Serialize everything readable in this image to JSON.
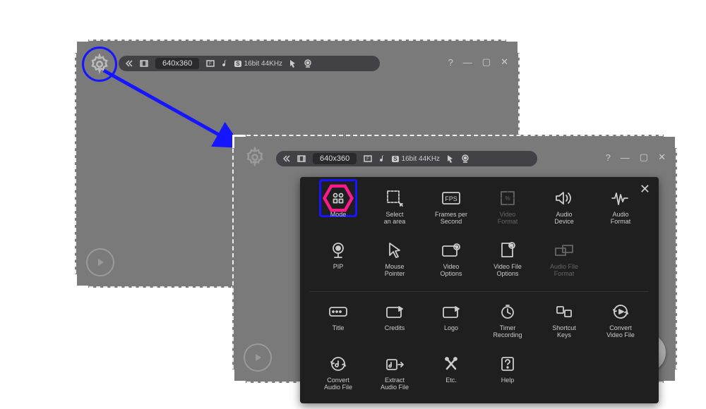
{
  "toolbar": {
    "dimensions": "640x360",
    "audio_badge_prefix": "S",
    "audio_mode": "16bit 44KHz"
  },
  "window_controls": {
    "help": "?",
    "min": "—",
    "max": "▢",
    "close": "✕"
  },
  "panel": {
    "items": [
      {
        "key": "mode",
        "label": "Mode"
      },
      {
        "key": "select-area",
        "label": "Select\nan area"
      },
      {
        "key": "fps",
        "label": "Frames per\nSecond"
      },
      {
        "key": "video-format",
        "label": "Video\nFormat",
        "dim": true
      },
      {
        "key": "audio-device",
        "label": "Audio\nDevice"
      },
      {
        "key": "audio-format",
        "label": "Audio\nFormat"
      },
      {
        "key": "pip",
        "label": "PIP"
      },
      {
        "key": "mouse-pointer",
        "label": "Mouse\nPointer"
      },
      {
        "key": "video-options",
        "label": "Video\nOptions"
      },
      {
        "key": "video-file-options",
        "label": "Video File\nOptions"
      },
      {
        "key": "audio-file-format",
        "label": "Audio File\nFormat",
        "dim": true
      },
      {
        "key": "blank1",
        "blank": true
      },
      {
        "key": "title",
        "label": "Title"
      },
      {
        "key": "credits",
        "label": "Credits"
      },
      {
        "key": "logo",
        "label": "Logo"
      },
      {
        "key": "timer",
        "label": "Timer\nRecording"
      },
      {
        "key": "shortcut",
        "label": "Shortcut\nKeys"
      },
      {
        "key": "convert-video",
        "label": "Convert\nVideo File"
      },
      {
        "key": "convert-audio",
        "label": "Convert\nAudio File"
      },
      {
        "key": "extract-audio",
        "label": "Extract\nAudio File"
      },
      {
        "key": "etc",
        "label": "Etc."
      },
      {
        "key": "help",
        "label": "Help"
      }
    ]
  }
}
